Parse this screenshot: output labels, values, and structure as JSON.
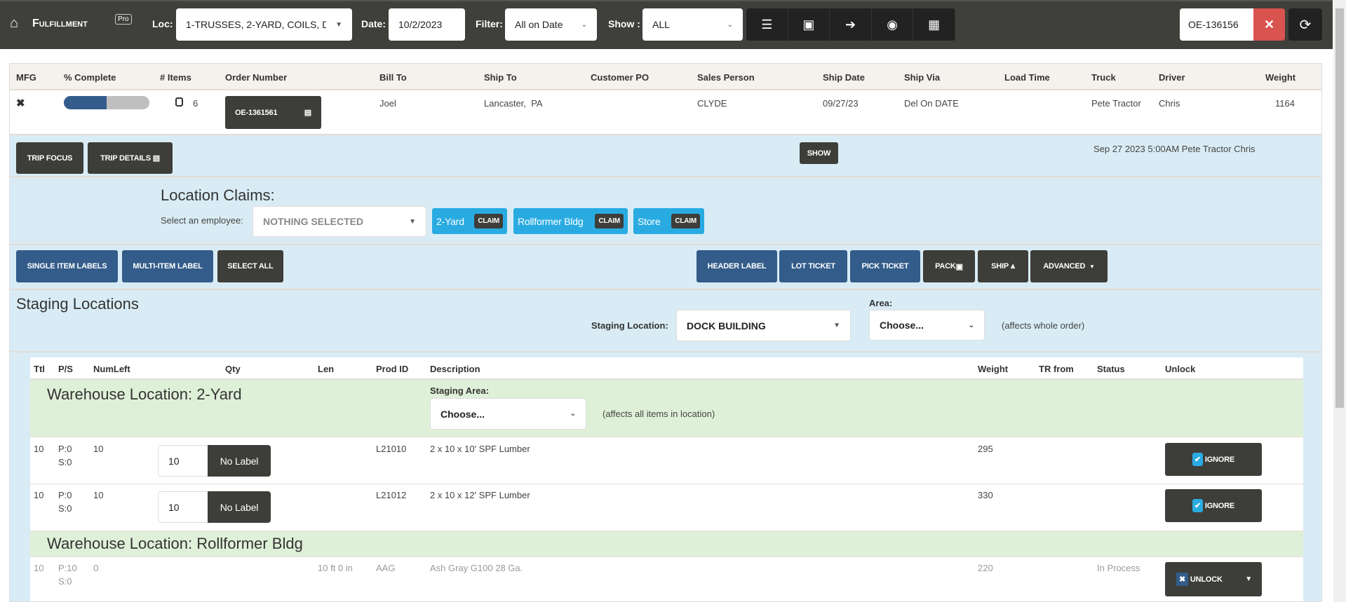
{
  "nav": {
    "app_name": "Fulfillment",
    "badge": "Pro",
    "loc_label": "Loc:",
    "loc_value": "1-TRUSSES, 2-YARD, COILS, D",
    "date_label": "Date:",
    "date_value": "10/2/2023",
    "filter_label": "Filter:",
    "filter_value": "All on Date",
    "show_label": "Show :",
    "show_value": "ALL",
    "search_value": "OE-136156"
  },
  "order_table": {
    "headers": [
      "MFG",
      "% Complete",
      "# Items",
      "Order Number",
      "Bill To",
      "Ship To",
      "Customer PO",
      "Sales Person",
      "Ship Date",
      "Ship Via",
      "Load Time",
      "Truck",
      "Driver",
      "Weight"
    ],
    "row": {
      "items": "6",
      "order_number": "OE-1361561",
      "bill_to": "Joel",
      "ship_to": "Lancaster,  PA",
      "customer_po": "",
      "sales_person": "CLYDE",
      "ship_date": "09/27/23",
      "ship_via": "Del On DATE",
      "load_time": "",
      "truck": "Pete Tractor",
      "driver": "Chris",
      "weight": "1164",
      "percent_complete": 50
    }
  },
  "trip": {
    "focus": "TRIP FOCUS",
    "details": "TRIP DETAILS",
    "show": "SHOW",
    "info": "Sep 27 2023 5:00AM Pete Tractor Chris"
  },
  "claims": {
    "title": "Location Claims:",
    "select_label": "Select an employee:",
    "select_value": "NOTHING SELECTED",
    "claim_label": "CLAIM",
    "locations": [
      "2-Yard",
      "Rollformer Bldg",
      "Store"
    ]
  },
  "actions": {
    "single": "SINGLE ITEM LABELS",
    "multi": "MULTI-ITEM LABEL",
    "select_all": "SELECT ALL",
    "header_label": "HEADER LABEL",
    "lot_ticket": "LOT TICKET",
    "pick_ticket": "PICK TICKET",
    "pack": "PACK",
    "ship": "SHIP",
    "advanced": "ADVANCED"
  },
  "staging": {
    "title": "Staging Locations",
    "location_label": "Staging Location:",
    "location_value": "DOCK BUILDING",
    "area_label": "Area:",
    "area_value": "Choose...",
    "area_note": "(affects whole order)"
  },
  "items": {
    "headers": [
      "Ttl",
      "P/S",
      "NumLeft",
      "Qty",
      "Len",
      "Prod ID",
      "Description",
      "Weight",
      "TR from",
      "Status",
      "Unlock"
    ],
    "groups": [
      {
        "title": "Warehouse Location: 2-Yard",
        "staging_label": "Staging Area:",
        "staging_value": "Choose...",
        "staging_note": "(affects all items in location)"
      },
      {
        "title": "Warehouse Location: Rollformer Bldg"
      }
    ],
    "rows": [
      {
        "ttl": "10",
        "p": "P:0",
        "s": "S:0",
        "numleft": "10",
        "qty": "10",
        "qty_btn": "No Label",
        "len": "",
        "prod": "L21010",
        "desc": "2 x 10 x 10' SPF Lumber",
        "weight": "295",
        "status": "",
        "action": "IGNORE"
      },
      {
        "ttl": "10",
        "p": "P:0",
        "s": "S:0",
        "numleft": "10",
        "qty": "10",
        "qty_btn": "No Label",
        "len": "",
        "prod": "L21012",
        "desc": "2 x 10 x 12' SPF Lumber",
        "weight": "330",
        "status": "",
        "action": "IGNORE"
      },
      {
        "ttl": "10",
        "p": "P:10",
        "s": "S:0",
        "numleft": "0",
        "len": "10 ft 0 in",
        "prod": "AAG",
        "desc": "Ash Gray G100 28 Ga.",
        "weight": "220",
        "status": "In Process",
        "action": "UNLOCK"
      }
    ]
  }
}
